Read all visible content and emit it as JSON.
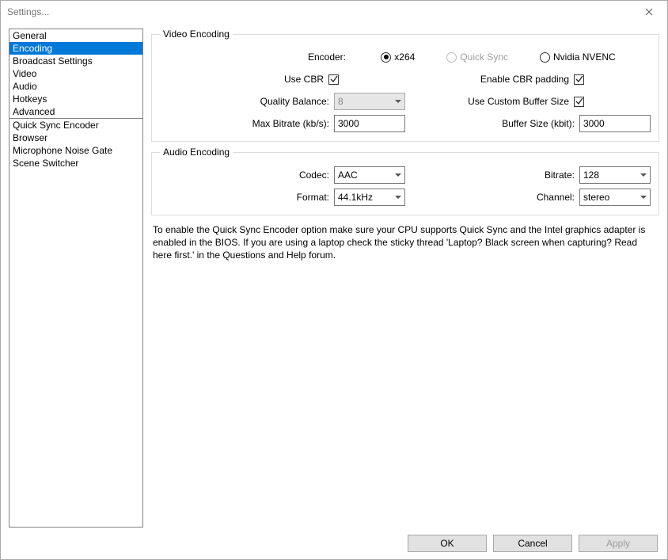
{
  "window": {
    "title": "Settings..."
  },
  "sidebar": {
    "items": [
      {
        "label": "General"
      },
      {
        "label": "Encoding",
        "selected": true
      },
      {
        "label": "Broadcast Settings"
      },
      {
        "label": "Video"
      },
      {
        "label": "Audio"
      },
      {
        "label": "Hotkeys"
      },
      {
        "label": "Advanced"
      }
    ],
    "items2": [
      {
        "label": "Quick Sync Encoder"
      },
      {
        "label": "Browser"
      },
      {
        "label": "Microphone Noise Gate"
      },
      {
        "label": "Scene Switcher"
      }
    ]
  },
  "video": {
    "legend": "Video Encoding",
    "encoder_label": "Encoder:",
    "enc_x264": "x264",
    "enc_qs": "Quick Sync",
    "enc_nvenc": "Nvidia NVENC",
    "use_cbr_label": "Use CBR",
    "cbr_padding_label": "Enable CBR padding",
    "quality_label": "Quality Balance:",
    "quality_value": "8",
    "custom_buf_label": "Use Custom Buffer Size",
    "max_bitrate_label": "Max Bitrate (kb/s):",
    "max_bitrate_value": "3000",
    "buf_size_label": "Buffer Size (kbit):",
    "buf_size_value": "3000"
  },
  "audio": {
    "legend": "Audio Encoding",
    "codec_label": "Codec:",
    "codec_value": "AAC",
    "bitrate_label": "Bitrate:",
    "bitrate_value": "128",
    "format_label": "Format:",
    "format_value": "44.1kHz",
    "channel_label": "Channel:",
    "channel_value": "stereo"
  },
  "info_text": "To enable the Quick Sync Encoder option make sure your CPU supports Quick Sync and the Intel graphics adapter is enabled in the BIOS. If you are using a laptop check the sticky thread 'Laptop? Black screen when capturing? Read here first.' in the Questions and Help forum.",
  "buttons": {
    "ok": "OK",
    "cancel": "Cancel",
    "apply": "Apply"
  }
}
